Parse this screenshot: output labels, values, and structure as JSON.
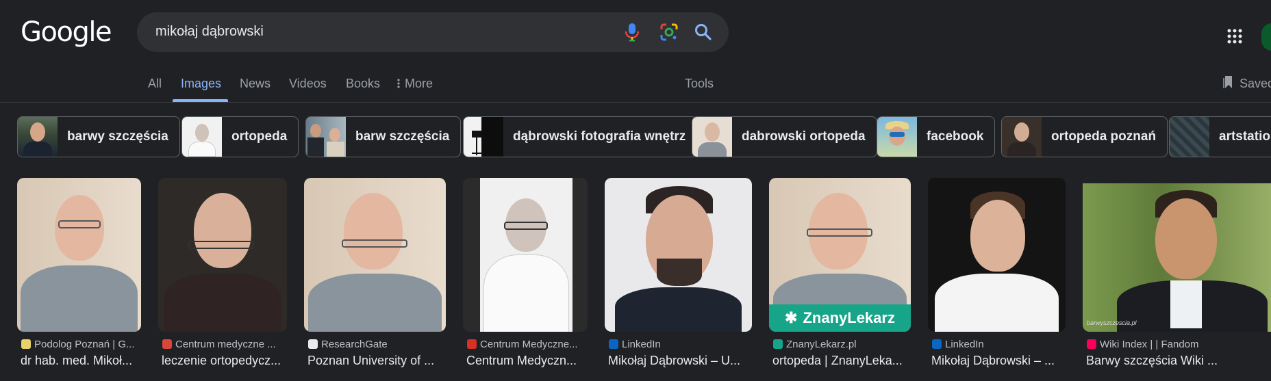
{
  "logo": "Google",
  "search": {
    "query": "mikołaj dąbrowski"
  },
  "tabs": [
    {
      "label": "All",
      "active": false
    },
    {
      "label": "Images",
      "active": true
    },
    {
      "label": "News",
      "active": false
    },
    {
      "label": "Videos",
      "active": false
    },
    {
      "label": "Books",
      "active": false
    },
    {
      "label": "More",
      "active": false
    }
  ],
  "tools_label": "Tools",
  "saved_label": "Saved",
  "chips": [
    {
      "label": "barwy szczęścia",
      "thumb": "man-suit"
    },
    {
      "label": "ortopeda",
      "thumb": "man-white-bg"
    },
    {
      "label": "barw szczęścia",
      "thumb": "two-people"
    },
    {
      "label": "dąbrowski fotografia wnętrz",
      "thumb": "camera-tripod-dark"
    },
    {
      "label": "dabrowski ortopeda",
      "thumb": "man-glasses"
    },
    {
      "label": "facebook",
      "thumb": "man-sunglasses-hat"
    },
    {
      "label": "ortopeda poznań",
      "thumb": "man-glasses-dark"
    },
    {
      "label": "artstation",
      "thumb": "dark-texture"
    }
  ],
  "results": [
    {
      "source": "Podolog Poznań | G...",
      "title": "dr hab. med. Mikoł...",
      "favicon_color": "#e8d36a"
    },
    {
      "source": "Centrum medyczne ...",
      "title": "leczenie ortopedycz...",
      "favicon_color": "#d9473b"
    },
    {
      "source": "ResearchGate",
      "title": "Poznan University of ...",
      "favicon_color": "#e8eaed"
    },
    {
      "source": "Centrum Medyczne...",
      "title": "Centrum Medyczn...",
      "favicon_color": "#d93025"
    },
    {
      "source": "LinkedIn",
      "title": "Mikołaj Dąbrowski – U...",
      "favicon_color": "#0a66c2"
    },
    {
      "source": "ZnanyLekarz.pl",
      "title": "ortopeda | ZnanyLeka...",
      "favicon_color": "#17a589",
      "badge": "ZnanyLekarz"
    },
    {
      "source": "LinkedIn",
      "title": "Mikołaj Dąbrowski – ...",
      "favicon_color": "#0a66c2"
    },
    {
      "source": "Wiki Index | | Fandom",
      "title": "Barwy szczęścia Wiki ...",
      "favicon_color": "#fa005a",
      "watermark": "barwyszczescia.pl"
    }
  ],
  "colors": {
    "background": "#202124",
    "accent": "#8ab4f8",
    "search_bg": "#303134"
  },
  "icons": [
    "mic-icon",
    "google-lens-icon",
    "search-icon",
    "apps-grid-icon",
    "bookmark-icon",
    "more-dots-icon"
  ]
}
